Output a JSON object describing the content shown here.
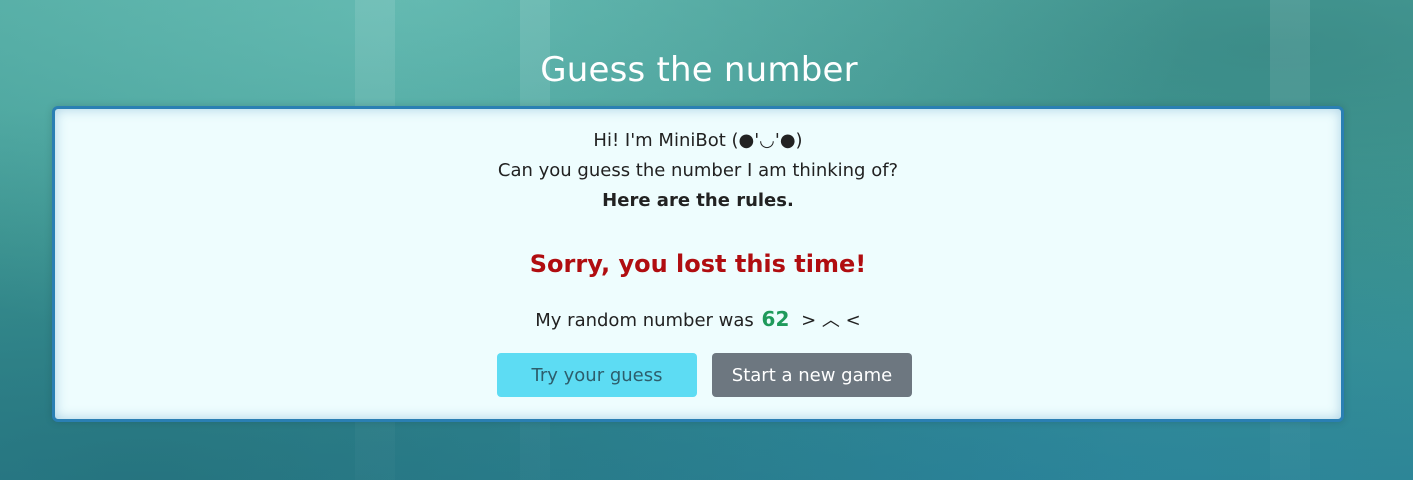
{
  "title": "Guess the number",
  "intro": {
    "greeting": "Hi! I'm MiniBot (●'◡'●)",
    "question": "Can you guess the number I am thinking of?",
    "rules_link": "Here are the rules."
  },
  "result": {
    "message": "Sorry, you lost this time!",
    "reveal_prefix": "My random number was",
    "number": "62",
    "face": "> ︿ <",
    "message_color": "#b00d10",
    "number_color": "#1f9a5b"
  },
  "buttons": {
    "guess_label": "Try your guess",
    "new_game_label": "Start a new game"
  }
}
